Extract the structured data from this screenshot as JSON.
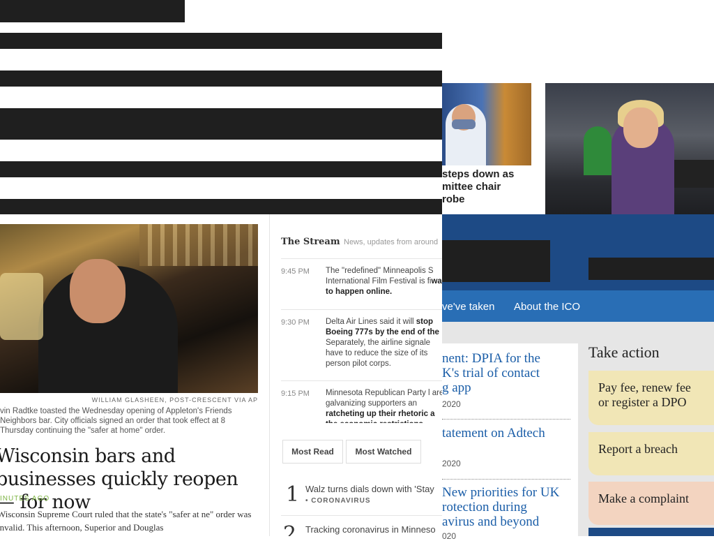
{
  "redaction_bars": [
    {
      "name": "redaction-bar-1"
    },
    {
      "name": "redaction-bar-2"
    },
    {
      "name": "redaction-bar-3"
    },
    {
      "name": "redaction-bar-4"
    },
    {
      "name": "redaction-bar-5"
    },
    {
      "name": "redaction-bar-6"
    }
  ],
  "top_story": {
    "title_lines": [
      "steps down as",
      "mittee chair",
      "robe"
    ]
  },
  "news": {
    "photo_credit": "WILLIAM GLASHEEN, POST-CRESCENT VIA AP",
    "caption": "vin Radtke toasted the Wednesday opening of Appleton's Friends Neighbors bar. City officials signed an order that took effect at 8 Thursday continuing the \"safer at home\" order.",
    "headline": "Wisconsin bars and businesses quickly reopen — for now",
    "time_ago": "INUTES AGO",
    "summary": "Wisconsin Supreme Court ruled that the state's \"safer at ne\" order was invalid. This afternoon, Superior and Douglas"
  },
  "stream": {
    "title": "The Stream",
    "subtitle": "News, updates from around",
    "items": [
      {
        "time": "9:45 PM",
        "text": "The \"redefined\" Minneapolis S International Film Festival is fi",
        "bold": "way to happen online."
      },
      {
        "time": "9:30 PM",
        "text": "Delta Air Lines said it will ",
        "bold": "stop Boeing 777s by the end of the",
        "after": " Separately, the airline signale have to reduce the size of its person pilot corps."
      },
      {
        "time": "9:15 PM",
        "text": "Minnesota Republican Party l are galvanizing supporters an ",
        "bold": "ratcheting up their rhetoric a the economic restrictions."
      }
    ]
  },
  "tabs": {
    "most_read": "Most Read",
    "most_watched": "Most Watched"
  },
  "ranked": [
    {
      "rank": "1",
      "title": "Walz turns dials down with 'Stay",
      "category": "• CORONAVIRUS"
    },
    {
      "rank": "2",
      "title": "Tracking coronavirus in Minneso"
    }
  ],
  "ico": {
    "nav": [
      "ve've taken",
      "About the ICO"
    ],
    "articles": [
      {
        "title_lines": [
          "nent: DPIA for the",
          "K's trial of contact",
          "g app"
        ],
        "date": "2020"
      },
      {
        "title_lines": [
          "tatement on Adtech"
        ],
        "date": "2020"
      },
      {
        "title_lines": [
          "New priorities for UK",
          "rotection during",
          "avirus and beyond"
        ],
        "date": "020"
      }
    ],
    "take_action": "Take action",
    "actions": [
      "Pay fee, renew fee or register a DPO",
      "Report a breach",
      "Make a complaint"
    ]
  }
}
